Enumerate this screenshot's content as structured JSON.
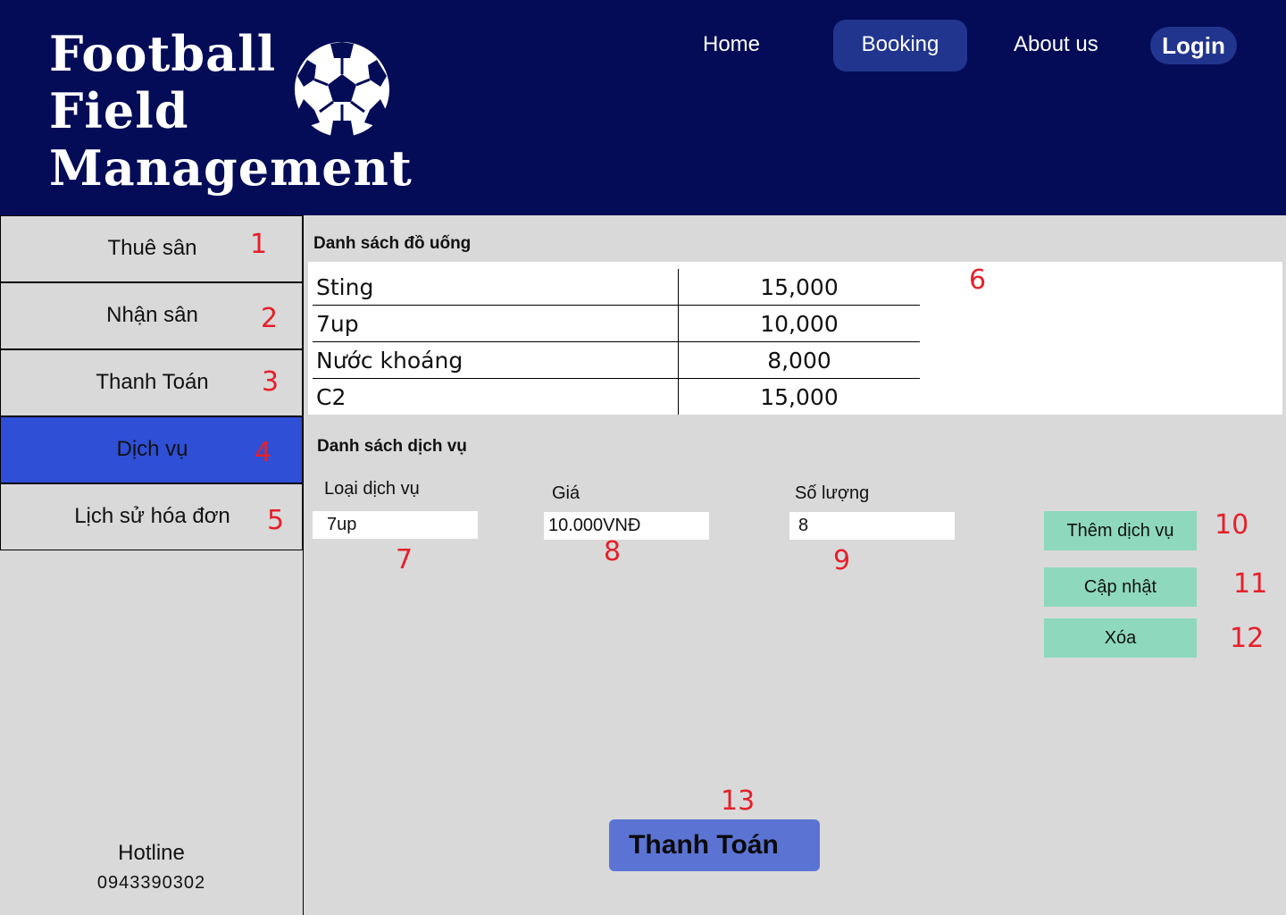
{
  "header": {
    "brand_lines": [
      "Football",
      "Field",
      "Management"
    ],
    "nav": {
      "home": "Home",
      "booking": "Booking",
      "about": "About us",
      "login": "Login"
    }
  },
  "sidebar": {
    "items": [
      {
        "label": "Thuê sân",
        "num": "1"
      },
      {
        "label": "Nhận sân",
        "num": "2"
      },
      {
        "label": "Thanh Toán",
        "num": "3"
      },
      {
        "label": "Dịch vụ",
        "num": "4",
        "active": true
      },
      {
        "label": "Lịch sử hóa đơn",
        "num": "5"
      }
    ],
    "hotline_label": "Hotline",
    "hotline_number": "0943390302"
  },
  "drinks": {
    "title": "Danh sách đồ uống",
    "num": "6",
    "rows": [
      {
        "name": "Sting",
        "price": "15,000"
      },
      {
        "name": "7up",
        "price": "10,000"
      },
      {
        "name": "Nước khoáng",
        "price": "8,000"
      },
      {
        "name": "C2",
        "price": "15,000"
      }
    ]
  },
  "services": {
    "title": "Danh sách dịch vụ",
    "type": {
      "label": "Loại dịch vụ",
      "value": "7up",
      "num": "7"
    },
    "price": {
      "label": "Giá",
      "value": "10.000VNĐ",
      "num": "8"
    },
    "quantity": {
      "label": "Số lượng",
      "value": "8",
      "num": "9"
    },
    "buttons": {
      "add": {
        "label": "Thêm dịch vụ",
        "num": "10"
      },
      "update": {
        "label": "Cập nhật",
        "num": "11"
      },
      "delete": {
        "label": "Xóa",
        "num": "12"
      }
    }
  },
  "payment": {
    "label": "Thanh Toán",
    "num": "13"
  },
  "colors": {
    "header": "#040c57",
    "nav_pill": "#21358e",
    "active_side": "#2f4fd6",
    "action_btn": "#8ed9bd",
    "pay_btn": "#5b74d4",
    "annotation": "#e5202a"
  }
}
